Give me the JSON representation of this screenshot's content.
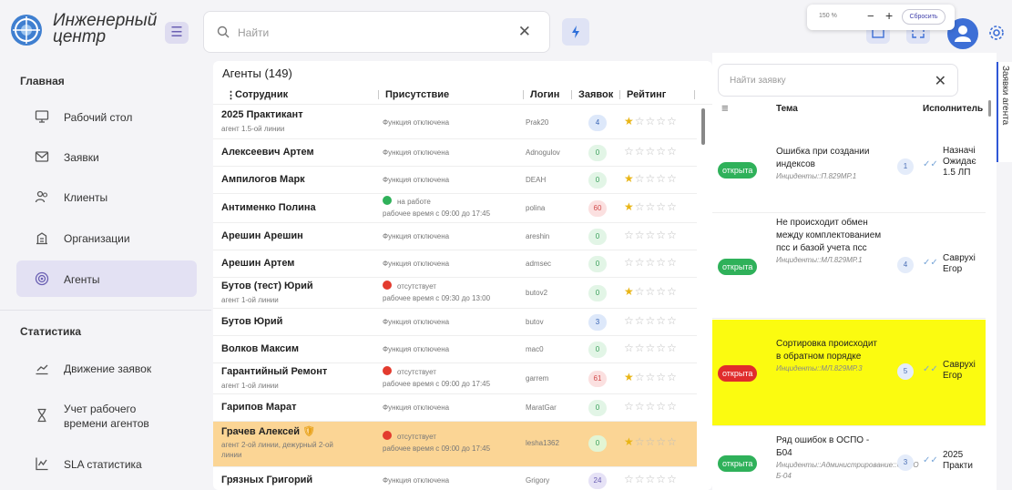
{
  "app": {
    "title_line1": "Инженерный",
    "title_line2": "центр"
  },
  "sidebar": {
    "section_main": "Главная",
    "items": [
      {
        "label": "Рабочий стол",
        "icon": "desktop-icon"
      },
      {
        "label": "Заявки",
        "icon": "mail-icon"
      },
      {
        "label": "Клиенты",
        "icon": "users-icon"
      },
      {
        "label": "Организации",
        "icon": "building-icon"
      },
      {
        "label": "Агенты",
        "icon": "target-icon",
        "active": true
      }
    ],
    "section_stats": "Статистика",
    "stats_items": [
      {
        "label": "Движение заявок",
        "icon": "chart-line-icon"
      },
      {
        "label_line1": "Учет рабочего",
        "label_line2": "времени агентов",
        "icon": "hourglass-icon"
      },
      {
        "label": "SLA статистика",
        "icon": "chart-icon"
      }
    ]
  },
  "topbar": {
    "search_placeholder": "Найти",
    "zoom_value": "150 %",
    "zoom_reset": "Сбросить"
  },
  "agents": {
    "title": "Агенты (149)",
    "columns": [
      "Сотрудник",
      "Присутствие",
      "Логин",
      "Заявок",
      "Рейтинг"
    ],
    "rows": [
      {
        "name": "2025 Практикант",
        "sub": "агент 1.5-ой линии",
        "presence": "Функция отключена",
        "login": "Prak20",
        "count": "4",
        "rating": 1
      },
      {
        "name": "Алексеевич Артем",
        "presence": "Функция отключена",
        "login": "Adnogulov",
        "count": "0",
        "rating": 0
      },
      {
        "name": "Ампилогов Марк",
        "presence": "Функция отключена",
        "login": "DEAH",
        "count": "0",
        "rating": 1
      },
      {
        "name": "Антименко Полина",
        "status": "на работе",
        "presence": "рабочее время с 09:00 до 17:45",
        "login": "polina",
        "count": "60",
        "rating": 1
      },
      {
        "name": "Арешин Арешин",
        "presence": "Функция отключена",
        "login": "areshin",
        "count": "0",
        "rating": 0
      },
      {
        "name": "Арешин Артем",
        "presence": "Функция отключена",
        "login": "admsec",
        "count": "0",
        "rating": 0
      },
      {
        "name": "Бутов (тест) Юрий",
        "sub": "агент 1-ой линии",
        "status": "отсутствует",
        "presence": "рабочее время с 09:30 до 13:00",
        "login": "butov2",
        "count": "0",
        "rating": 1
      },
      {
        "name": "Бутов Юрий",
        "presence": "Функция отключена",
        "login": "butov",
        "count": "3",
        "rating": 0
      },
      {
        "name": "Волков Максим",
        "presence": "Функция отключена",
        "login": "mac0",
        "count": "0",
        "rating": 0
      },
      {
        "name": "Гарантийный Ремонт",
        "sub": "агент 1-ой линии",
        "status": "отсутствует",
        "presence": "рабочее время с 09:00 до 17:45",
        "login": "garrem",
        "count": "61",
        "rating": 1
      },
      {
        "name": "Гарипов Марат",
        "presence": "Функция отключена",
        "login": "MaratGar",
        "count": "0",
        "rating": 0
      },
      {
        "name": "Грачев Алексей",
        "sub_line1": "агент 2-ой линии, дежурный 2-ой",
        "sub_line2": "линии",
        "status": "отсутствует",
        "presence": "рабочее время с 09:00 до 17:45",
        "login": "lesha1362",
        "count": "0",
        "rating": 1
      },
      {
        "name": "Грязных Григорий",
        "presence": "Функция отключена",
        "login": "Grigory",
        "count": "24",
        "rating": 0
      }
    ]
  },
  "requests": {
    "search_placeholder": "Найти заявку",
    "columns": [
      "Тема",
      "Исполнитель"
    ],
    "side_tab": "Заявки агента",
    "items": [
      {
        "status": "открыта",
        "title": "Ошибка при создании индексов",
        "incident": "Инциденты::П.829МР.1",
        "num": "1",
        "exec_line1": "Назначі",
        "exec_line2": "Ожидає",
        "exec_line3": "1.5 ЛП"
      },
      {
        "status": "открыта",
        "title": "Не происходит обмен между комплектованием псс и базой учета псс",
        "incident": "Инциденты::МЛ.829МР.1",
        "num": "4",
        "exec_line1": "Саврухі",
        "exec_line2": "Егор"
      },
      {
        "status": "открыта",
        "title": "Сортировка происходит в обратном порядке",
        "incident": "Инциденты::МЛ.829МР.3",
        "num": "5",
        "exec_line1": "Саврухі",
        "exec_line2": "Егор"
      },
      {
        "status": "открыта",
        "title": "Ряд ошибок в ОСПО - Б04",
        "incident": "Инциденты::Администрирование::ОСПО Б-04",
        "num": "3",
        "exec_line1": "2025",
        "exec_line2": "Практи"
      }
    ]
  }
}
